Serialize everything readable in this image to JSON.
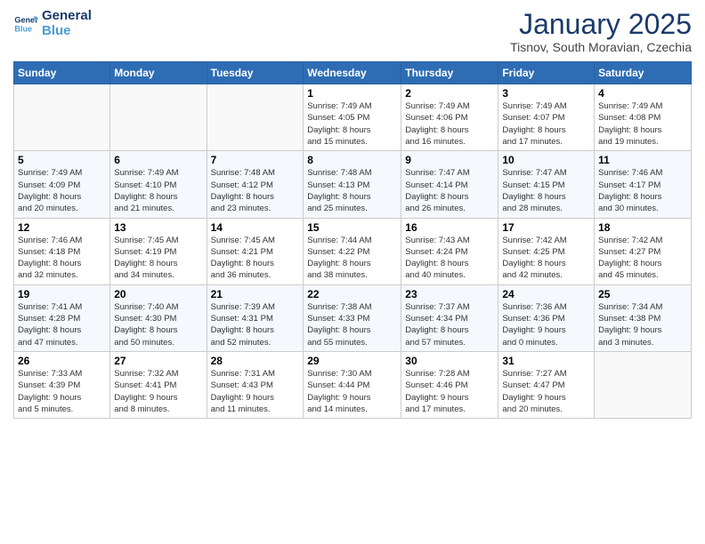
{
  "logo": {
    "line1": "General",
    "line2": "Blue"
  },
  "title": "January 2025",
  "location": "Tisnov, South Moravian, Czechia",
  "weekdays": [
    "Sunday",
    "Monday",
    "Tuesday",
    "Wednesday",
    "Thursday",
    "Friday",
    "Saturday"
  ],
  "weeks": [
    [
      {
        "num": "",
        "info": ""
      },
      {
        "num": "",
        "info": ""
      },
      {
        "num": "",
        "info": ""
      },
      {
        "num": "1",
        "info": "Sunrise: 7:49 AM\nSunset: 4:05 PM\nDaylight: 8 hours\nand 15 minutes."
      },
      {
        "num": "2",
        "info": "Sunrise: 7:49 AM\nSunset: 4:06 PM\nDaylight: 8 hours\nand 16 minutes."
      },
      {
        "num": "3",
        "info": "Sunrise: 7:49 AM\nSunset: 4:07 PM\nDaylight: 8 hours\nand 17 minutes."
      },
      {
        "num": "4",
        "info": "Sunrise: 7:49 AM\nSunset: 4:08 PM\nDaylight: 8 hours\nand 19 minutes."
      }
    ],
    [
      {
        "num": "5",
        "info": "Sunrise: 7:49 AM\nSunset: 4:09 PM\nDaylight: 8 hours\nand 20 minutes."
      },
      {
        "num": "6",
        "info": "Sunrise: 7:49 AM\nSunset: 4:10 PM\nDaylight: 8 hours\nand 21 minutes."
      },
      {
        "num": "7",
        "info": "Sunrise: 7:48 AM\nSunset: 4:12 PM\nDaylight: 8 hours\nand 23 minutes."
      },
      {
        "num": "8",
        "info": "Sunrise: 7:48 AM\nSunset: 4:13 PM\nDaylight: 8 hours\nand 25 minutes."
      },
      {
        "num": "9",
        "info": "Sunrise: 7:47 AM\nSunset: 4:14 PM\nDaylight: 8 hours\nand 26 minutes."
      },
      {
        "num": "10",
        "info": "Sunrise: 7:47 AM\nSunset: 4:15 PM\nDaylight: 8 hours\nand 28 minutes."
      },
      {
        "num": "11",
        "info": "Sunrise: 7:46 AM\nSunset: 4:17 PM\nDaylight: 8 hours\nand 30 minutes."
      }
    ],
    [
      {
        "num": "12",
        "info": "Sunrise: 7:46 AM\nSunset: 4:18 PM\nDaylight: 8 hours\nand 32 minutes."
      },
      {
        "num": "13",
        "info": "Sunrise: 7:45 AM\nSunset: 4:19 PM\nDaylight: 8 hours\nand 34 minutes."
      },
      {
        "num": "14",
        "info": "Sunrise: 7:45 AM\nSunset: 4:21 PM\nDaylight: 8 hours\nand 36 minutes."
      },
      {
        "num": "15",
        "info": "Sunrise: 7:44 AM\nSunset: 4:22 PM\nDaylight: 8 hours\nand 38 minutes."
      },
      {
        "num": "16",
        "info": "Sunrise: 7:43 AM\nSunset: 4:24 PM\nDaylight: 8 hours\nand 40 minutes."
      },
      {
        "num": "17",
        "info": "Sunrise: 7:42 AM\nSunset: 4:25 PM\nDaylight: 8 hours\nand 42 minutes."
      },
      {
        "num": "18",
        "info": "Sunrise: 7:42 AM\nSunset: 4:27 PM\nDaylight: 8 hours\nand 45 minutes."
      }
    ],
    [
      {
        "num": "19",
        "info": "Sunrise: 7:41 AM\nSunset: 4:28 PM\nDaylight: 8 hours\nand 47 minutes."
      },
      {
        "num": "20",
        "info": "Sunrise: 7:40 AM\nSunset: 4:30 PM\nDaylight: 8 hours\nand 50 minutes."
      },
      {
        "num": "21",
        "info": "Sunrise: 7:39 AM\nSunset: 4:31 PM\nDaylight: 8 hours\nand 52 minutes."
      },
      {
        "num": "22",
        "info": "Sunrise: 7:38 AM\nSunset: 4:33 PM\nDaylight: 8 hours\nand 55 minutes."
      },
      {
        "num": "23",
        "info": "Sunrise: 7:37 AM\nSunset: 4:34 PM\nDaylight: 8 hours\nand 57 minutes."
      },
      {
        "num": "24",
        "info": "Sunrise: 7:36 AM\nSunset: 4:36 PM\nDaylight: 9 hours\nand 0 minutes."
      },
      {
        "num": "25",
        "info": "Sunrise: 7:34 AM\nSunset: 4:38 PM\nDaylight: 9 hours\nand 3 minutes."
      }
    ],
    [
      {
        "num": "26",
        "info": "Sunrise: 7:33 AM\nSunset: 4:39 PM\nDaylight: 9 hours\nand 5 minutes."
      },
      {
        "num": "27",
        "info": "Sunrise: 7:32 AM\nSunset: 4:41 PM\nDaylight: 9 hours\nand 8 minutes."
      },
      {
        "num": "28",
        "info": "Sunrise: 7:31 AM\nSunset: 4:43 PM\nDaylight: 9 hours\nand 11 minutes."
      },
      {
        "num": "29",
        "info": "Sunrise: 7:30 AM\nSunset: 4:44 PM\nDaylight: 9 hours\nand 14 minutes."
      },
      {
        "num": "30",
        "info": "Sunrise: 7:28 AM\nSunset: 4:46 PM\nDaylight: 9 hours\nand 17 minutes."
      },
      {
        "num": "31",
        "info": "Sunrise: 7:27 AM\nSunset: 4:47 PM\nDaylight: 9 hours\nand 20 minutes."
      },
      {
        "num": "",
        "info": ""
      }
    ]
  ]
}
